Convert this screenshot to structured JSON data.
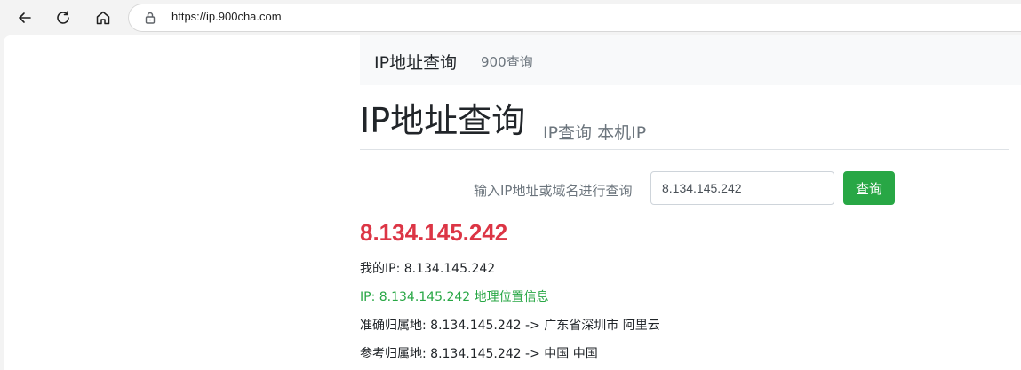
{
  "browser": {
    "url": "https://ip.900cha.com",
    "icons": [
      "back-arrow-icon",
      "reload-icon",
      "home-icon",
      "lock-icon"
    ]
  },
  "site": {
    "brand": "IP地址查询",
    "nav_link": "900查询"
  },
  "header": {
    "title": "IP地址查询",
    "subtitle": "IP查询 本机IP"
  },
  "search": {
    "label": "输入IP地址或域名进行查询",
    "value": "8.134.145.242",
    "button_label": "查询"
  },
  "result": {
    "ip": "8.134.145.242",
    "my_ip": "我的IP: 8.134.145.242",
    "geo_link": "IP: 8.134.145.242 地理位置信息",
    "precise": "准确归属地: 8.134.145.242 -> 广东省深圳市 阿里云",
    "reference": "参考归属地: 8.134.145.242 -> 中国 中国"
  },
  "colors": {
    "accent_green": "#28a745",
    "result_red": "#dc3545",
    "navbar_bg": "#f8f9fa"
  }
}
